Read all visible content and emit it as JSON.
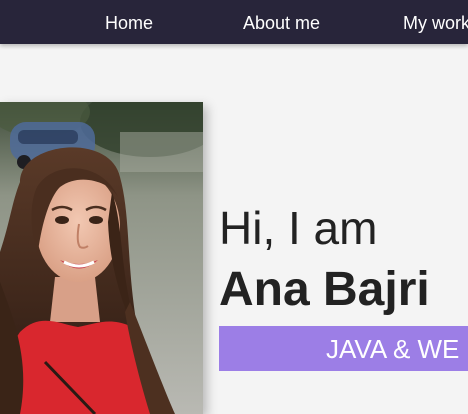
{
  "nav": {
    "items": [
      {
        "label": "Home"
      },
      {
        "label": "About me"
      },
      {
        "label": "My work"
      }
    ]
  },
  "hero": {
    "greeting": "Hi, I am",
    "name": "Ana Bajri",
    "role": "JAVA & WE"
  },
  "colors": {
    "nav_background": "#28253a",
    "page_background": "#f4f4f4",
    "role_bar": "#9c7ee6",
    "heading_text": "#222222"
  }
}
